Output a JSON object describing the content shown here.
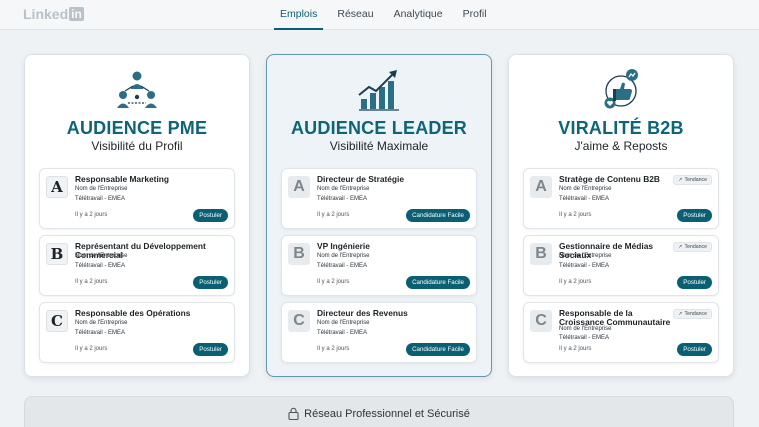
{
  "app": {
    "logo_text": "Linked",
    "logo_box": "in"
  },
  "nav": {
    "tabs": [
      {
        "label": "Emplois",
        "active": true
      },
      {
        "label": "Réseau"
      },
      {
        "label": "Analytique"
      },
      {
        "label": "Profil"
      }
    ]
  },
  "columns": [
    {
      "icon": "audience-network-icon",
      "title": "AUDIENCE PME",
      "subtitle": "Visibilité du Profil",
      "jobs": [
        {
          "logo": "A",
          "title": "Responsable Marketing",
          "company": "Nom de l'Entreprise",
          "location": "Télétravail - EMEA",
          "time": "Il y a 2 jours",
          "action": "Postuler"
        },
        {
          "logo": "B",
          "title": "Représentant du Développement Commercial",
          "company": "Nom de l'Entreprise",
          "location": "Télétravail - EMEA",
          "time": "Il y a 2 jours",
          "action": "Postuler"
        },
        {
          "logo": "C",
          "title": "Responsable des Opérations",
          "company": "Nom de l'Entreprise",
          "location": "Télétravail - EMEA",
          "time": "Il y a 2 jours",
          "action": "Postuler"
        }
      ]
    },
    {
      "icon": "growth-chart-icon",
      "title": "AUDIENCE LEADER",
      "subtitle": "Visibilité Maximale",
      "jobs": [
        {
          "logo": "A",
          "title": "Directeur de Stratégie",
          "company": "Nom de l'Entreprise",
          "location": "Télétravail - EMEA",
          "time": "Il y a 2 jours",
          "action": "Candidature Facile"
        },
        {
          "logo": "B",
          "title": "VP Ingénierie",
          "company": "Nom de l'Entreprise",
          "location": "Télétravail - EMEA",
          "time": "Il y a 2 jours",
          "action": "Candidature Facile"
        },
        {
          "logo": "C",
          "title": "Directeur des Revenus",
          "company": "Nom de l'Entreprise",
          "location": "Télétravail - EMEA",
          "time": "Il y a 2 jours",
          "action": "Candidature Facile"
        }
      ]
    },
    {
      "icon": "social-reactions-icon",
      "title": "VIRALITÉ B2B",
      "subtitle": "J'aime & Reposts",
      "jobs": [
        {
          "logo": "A",
          "title": "Stratège de Contenu B2B",
          "company": "Nom de l'Entreprise",
          "location": "Télétravail - EMEA",
          "time": "Il y a 2 jours",
          "action": "Postuler",
          "badge": "Tendance"
        },
        {
          "logo": "B",
          "title": "Gestionnaire de Médias Sociaux",
          "company": "Nom de l'Entreprise",
          "location": "Télétravail - EMEA",
          "time": "Il y a 2 jours",
          "action": "Postuler",
          "badge": "Tendance"
        },
        {
          "logo": "C",
          "title": "Responsable de la Croissance Communautaire",
          "company": "Nom de l'Entreprise",
          "location": "Télétravail - EMEA",
          "time": "Il y a 2 jours",
          "action": "Postuler",
          "badge": "Tendance"
        }
      ]
    }
  ],
  "footer": {
    "text": "Réseau Professionnel et Sécurisé",
    "icon": "lock-icon"
  },
  "colors": {
    "accent": "#0b5f73",
    "title": "#0d6577",
    "background": "#eef2f5"
  }
}
